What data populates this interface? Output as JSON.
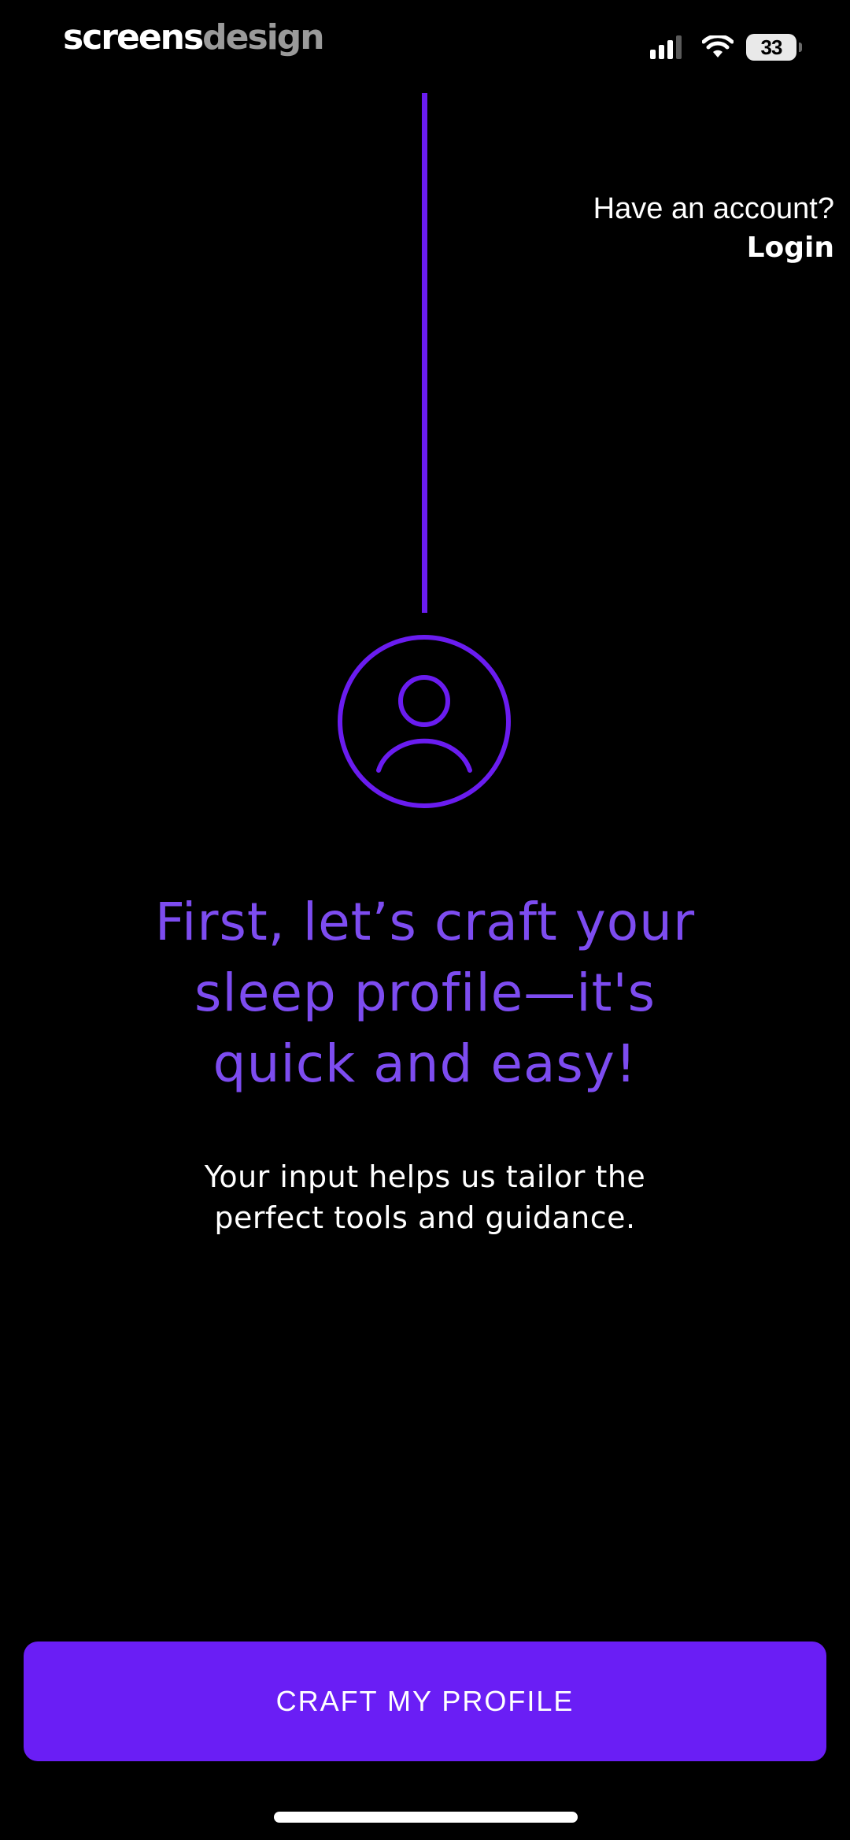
{
  "watermark": {
    "part1": "screens",
    "part2": "design"
  },
  "status_bar": {
    "battery": "33",
    "icons": [
      "cellular-signal-icon",
      "wifi-icon",
      "battery-icon"
    ]
  },
  "header": {
    "prompt": "Have an account?",
    "login_label": "Login"
  },
  "main": {
    "icon": "user-profile-icon",
    "headline_lines": [
      "First, let’s craft your",
      "sleep profile—it's",
      "quick and easy!"
    ],
    "subtext_lines": [
      "Your input helps us tailor the",
      "perfect tools and guidance."
    ]
  },
  "cta": {
    "label": "CRAFT MY PROFILE"
  },
  "colors": {
    "background": "#000000",
    "accent": "#6a1ef5",
    "headline": "#7d4cf0",
    "text": "#ffffff"
  }
}
